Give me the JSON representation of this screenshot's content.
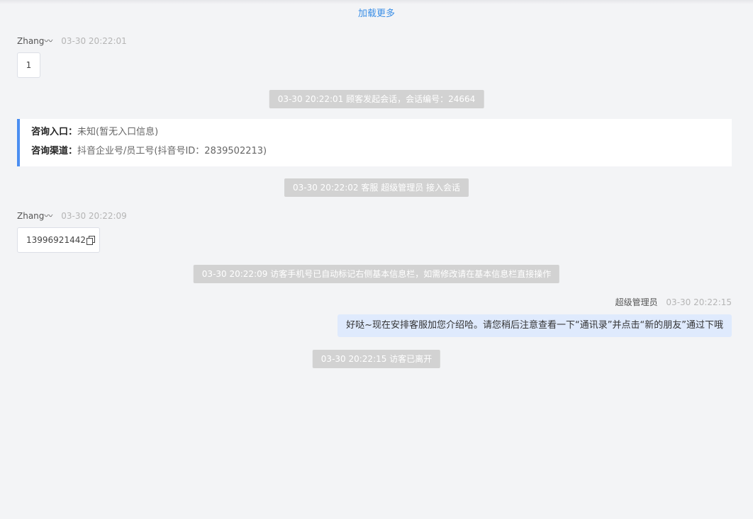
{
  "load_more": "加载更多",
  "messages": {
    "m1": {
      "sender": "Zhang〰",
      "time": "03-30 20:22:01",
      "text": "1"
    },
    "m2": {
      "sender": "Zhang〰",
      "time": "03-30 20:22:09",
      "text": "13996921442"
    },
    "agent": {
      "sender": "超级管理员",
      "time": "03-30 20:22:15",
      "text": "好哒~现在安排客服加您介绍哈。请您稍后注意查看一下“通讯录”并点击“新的朋友”通过下哦"
    }
  },
  "system": {
    "s1": "03-30 20:22:01 顾客发起会话，会话编号：24664",
    "s2": "03-30 20:22:02 客服 超级管理员 接入会话",
    "s3": "03-30 20:22:09 访客手机号已自动标记右侧基本信息栏，如需修改请在基本信息栏直接操作",
    "s4": "03-30 20:22:15 访客已离开"
  },
  "info": {
    "entry_label": "咨询入口：",
    "entry_value": "未知(暂无入口信息)",
    "channel_label": "咨询渠道：",
    "channel_value": "抖音企业号/员工号(抖音号ID：2839502213)"
  },
  "icons": {
    "copy": "copy-icon"
  },
  "colors": {
    "background": "#f3f4f6",
    "link": "#3a8ee6",
    "system_pill": "#d2d2d2",
    "info_accent": "#4b8ef1",
    "agent_bubble": "#dfeafd"
  }
}
